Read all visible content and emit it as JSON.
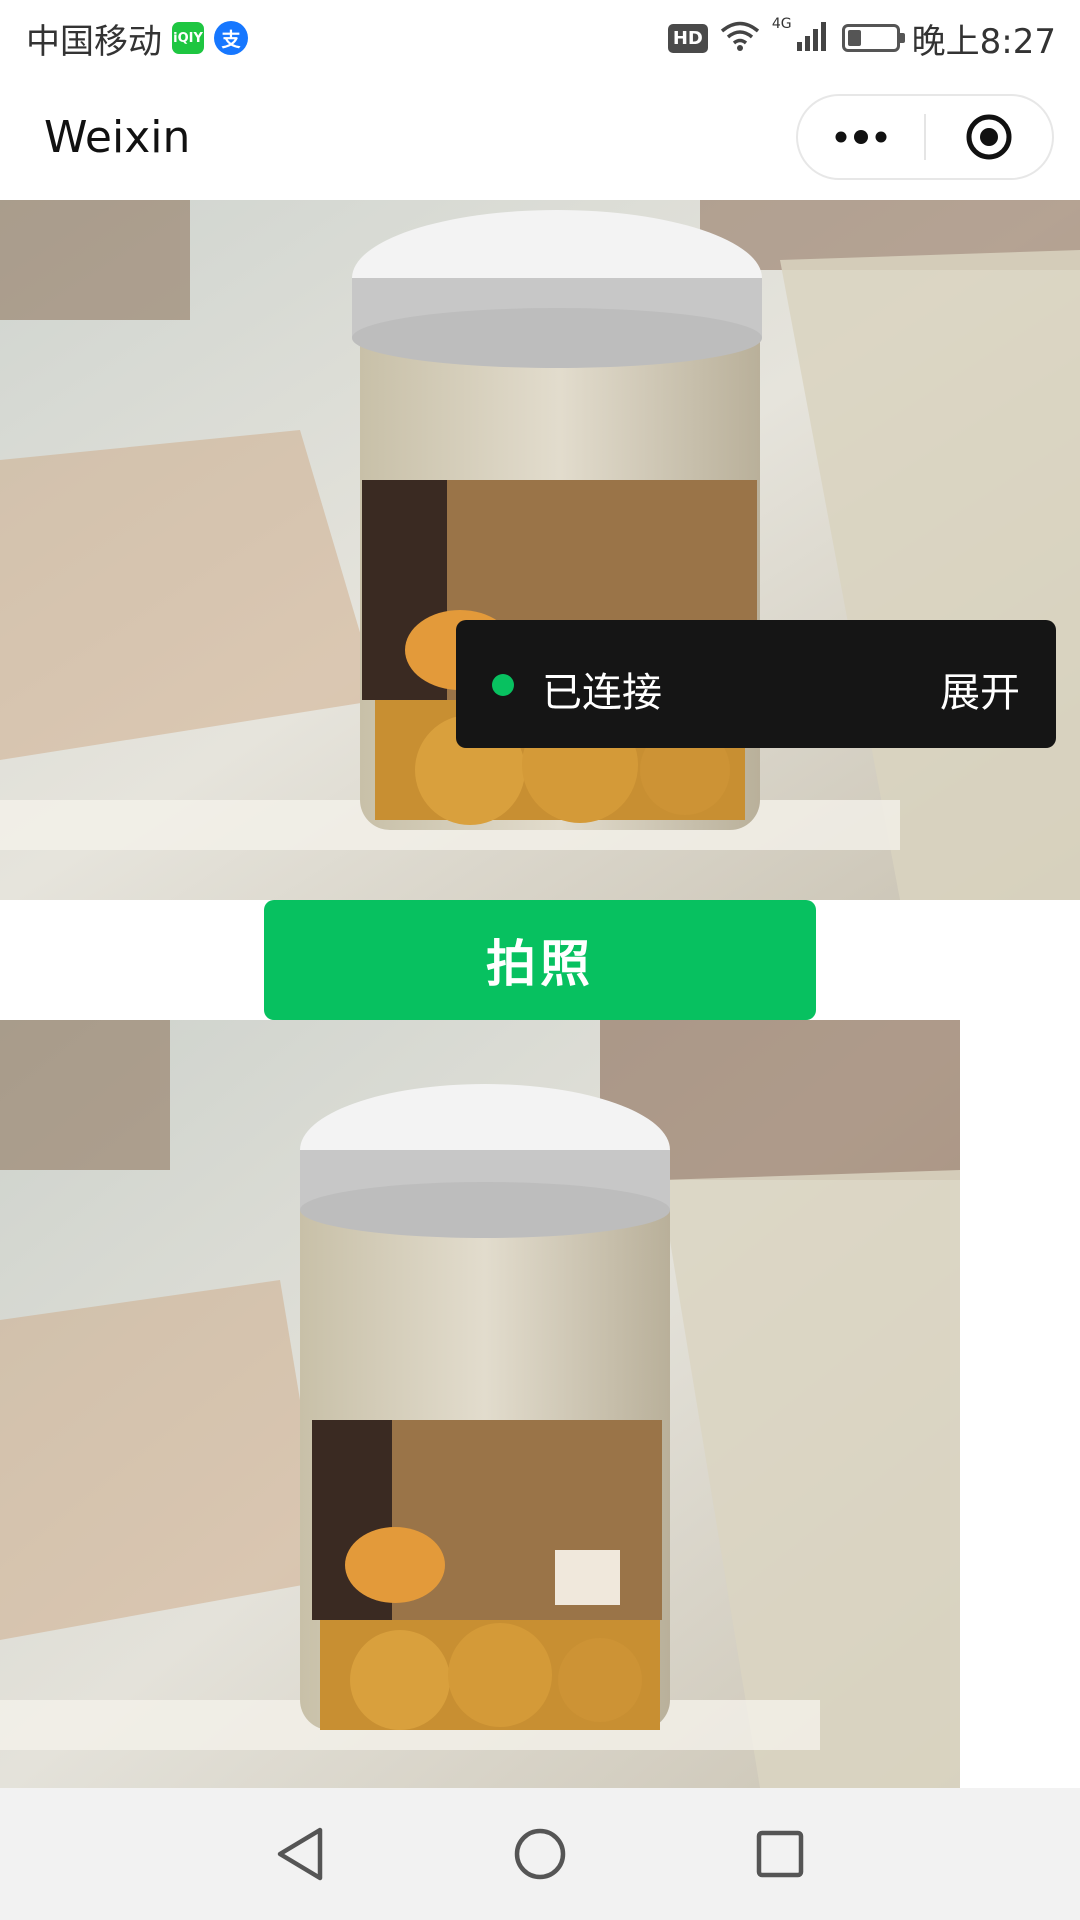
{
  "status_bar": {
    "carrier": "中国移动",
    "iqiyi_badge": "iQIY",
    "alipay_badge": "支",
    "hd_label": "HD",
    "network_label": "4G",
    "battery_level": 0.3,
    "time": "晚上8:27"
  },
  "nav_bar": {
    "title": "Weixin",
    "more_icon": "more-dots-icon",
    "close_icon": "target-circle-icon"
  },
  "camera": {
    "toast": {
      "status": "已连接",
      "action": "展开",
      "dot_color": "#08c160"
    }
  },
  "capture_button": {
    "label": "拍照",
    "color": "#07c160"
  },
  "android_nav": {
    "back_icon": "back-triangle-icon",
    "home_icon": "home-circle-icon",
    "recents_icon": "recents-square-icon"
  }
}
